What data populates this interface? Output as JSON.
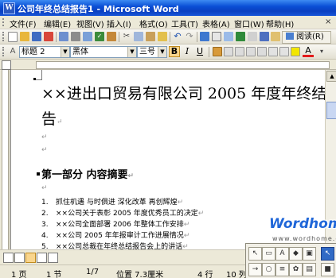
{
  "window": {
    "title": "公司年终总结报告1 - Microsoft Word",
    "app_icon": "W"
  },
  "menu": {
    "items": [
      "文件(F)",
      "编辑(E)",
      "视图(V)",
      "插入(I)",
      "格式(O)",
      "工具(T)",
      "表格(A)",
      "窗口(W)",
      "帮助(H)"
    ],
    "close_glyph": "×"
  },
  "standard_toolbar": {
    "read_label": "阅读(R)",
    "icons": [
      "new-doc-icon",
      "open-icon",
      "save-icon",
      "permission-icon",
      "email-icon",
      "print-icon",
      "print-preview-icon",
      "spelling-icon",
      "research-icon",
      "cut-icon",
      "copy-icon",
      "paste-icon",
      "format-painter-icon",
      "undo-icon",
      "redo-icon",
      "hyperlink-icon",
      "tables-icon",
      "insert-table-icon",
      "excel-icon",
      "columns-icon",
      "drawing-icon",
      "document-map-icon",
      "show-hide-icon",
      "zoom-icon",
      "help-icon"
    ]
  },
  "format_toolbar": {
    "style_value": "标题 2",
    "font_value": "黑体",
    "size_value": "三号",
    "bold_label": "B",
    "italic_label": "I",
    "underline_label": "U",
    "font_color_label": "A",
    "font_color": "#e31b1b",
    "highlight_color": "#f2e600"
  },
  "document": {
    "title": "××进出口贸易有限公司 2005 年度年终结报告",
    "para_mark": "↵",
    "section_title": "第一部分    内容摘要",
    "list": [
      {
        "num": "1.",
        "text": "抓住机遇 与时俱进 深化改革 再创辉煌"
      },
      {
        "num": "2.",
        "text": "××公司关于表彰 2005 年度优秀员工的决定"
      },
      {
        "num": "3.",
        "text": "××公司全面部署 2006 年整体工作安排"
      },
      {
        "num": "4.",
        "text": "××公司 2005 年年报审计工作进展情况"
      },
      {
        "num": "5.",
        "text": "××公司总裁在年终总结报告会上的讲话"
      }
    ]
  },
  "statusbar": {
    "page": "1 页",
    "section": "1 节",
    "page_of": "1/7",
    "position": "位置 7.3厘米",
    "line": "4 行",
    "column": "10 列"
  },
  "watermark": {
    "brand": "Wordhome",
    "url": "www.wordhome.com.cn"
  },
  "colors": {
    "titlebar": "#0a4fd6",
    "accent_blue": "#316ac5"
  }
}
